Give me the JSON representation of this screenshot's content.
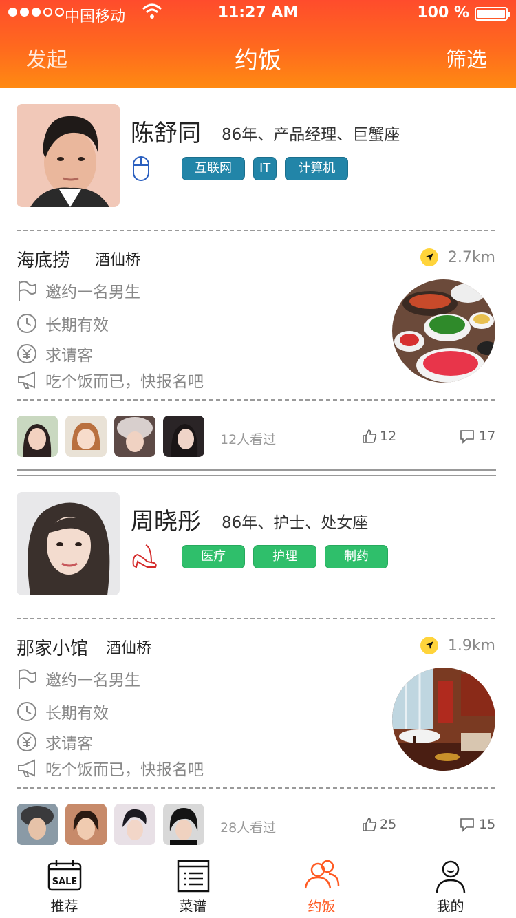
{
  "status_bar": {
    "carrier": "中国移动",
    "time": "11:27 AM",
    "battery": "100 %"
  },
  "nav": {
    "left": "发起",
    "title": "约饭",
    "right": "筛选"
  },
  "posts": [
    {
      "user": {
        "name": "陈舒同",
        "meta": "86年、产品经理、巨蟹座",
        "gender_icon": "mouse-icon",
        "tags": [
          "互联网",
          "IT",
          "计算机"
        ]
      },
      "restaurant": "海底捞",
      "district": "酒仙桥",
      "distance": "2.7km",
      "invite": "邀约一名男生",
      "validity": "长期有效",
      "payment": "求请客",
      "slogan": "吃个饭而已，快报名吧",
      "viewed": "12人看过",
      "likes": "12",
      "comments": "17"
    },
    {
      "user": {
        "name": "周晓彤",
        "meta": "86年、护士、处女座",
        "gender_icon": "high-heel-icon",
        "tags": [
          "医疗",
          "护理",
          "制药"
        ]
      },
      "restaurant": "那家小馆",
      "district": "酒仙桥",
      "distance": "1.9km",
      "invite": "邀约一名男生",
      "validity": "长期有效",
      "payment": "求请客",
      "slogan": "吃个饭而已，快报名吧",
      "viewed": "28人看过",
      "likes": "25",
      "comments": "15"
    }
  ],
  "tabs": [
    {
      "label": "推荐",
      "icon": "sale-calendar-icon"
    },
    {
      "label": "菜谱",
      "icon": "menu-list-icon"
    },
    {
      "label": "约饭",
      "icon": "people-icon",
      "active": true
    },
    {
      "label": "我的",
      "icon": "user-icon"
    }
  ],
  "colors": {
    "header_start": "#ff4c2c",
    "header_end": "#ff8a12",
    "tag_blue": "#2285a8",
    "tag_green": "#2fbf6b",
    "active_tab": "#ff5a22",
    "location_badge": "#ffd43b"
  }
}
